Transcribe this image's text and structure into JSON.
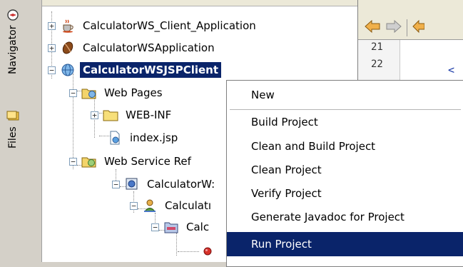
{
  "side_tabs": [
    {
      "label": "Navigator",
      "icon": "navigator-icon"
    },
    {
      "label": "Files",
      "icon": "files-icon"
    }
  ],
  "tree": [
    {
      "label": "CalculatorWS_Client_Application",
      "icon": "java-cup-icon",
      "expander": "+"
    },
    {
      "label": "CalculatorWSApplication",
      "icon": "bean-icon",
      "expander": "+"
    },
    {
      "label": "CalculatorWSJSPClient",
      "icon": "globe-icon",
      "expander": "−",
      "selected": true
    },
    {
      "label": "Web Pages",
      "icon": "web-folder-icon",
      "expander": "−"
    },
    {
      "label": "WEB-INF",
      "icon": "folder-icon",
      "expander": "+"
    },
    {
      "label": "index.jsp",
      "icon": "jsp-file-icon"
    },
    {
      "label": "Web Service Ref",
      "icon": "ws-folder-icon",
      "expander": "−"
    },
    {
      "label": "CalculatorW:",
      "icon": "ws-reference-icon",
      "expander": "−"
    },
    {
      "label": "Calculatı",
      "icon": "ws-service-icon",
      "expander": "−"
    },
    {
      "label": "Calc",
      "icon": "ws-port-icon",
      "expander": "−"
    },
    {
      "label": "",
      "icon": "ws-operation-icon"
    }
  ],
  "editor": {
    "line_numbers": [
      "21",
      "22"
    ],
    "caret_glyph": "<"
  },
  "context_menu": {
    "items": [
      {
        "label": "New"
      },
      {
        "label": "Build Project"
      },
      {
        "label": "Clean and Build Project"
      },
      {
        "label": "Clean Project"
      },
      {
        "label": "Verify Project"
      },
      {
        "label": "Generate Javadoc for Project"
      },
      {
        "label": "Run Project",
        "highlighted": true
      }
    ]
  },
  "colors": {
    "selection": "#0a246a",
    "panel": "#d4d0c8",
    "toolbar_arrow": "#e8a23a"
  }
}
